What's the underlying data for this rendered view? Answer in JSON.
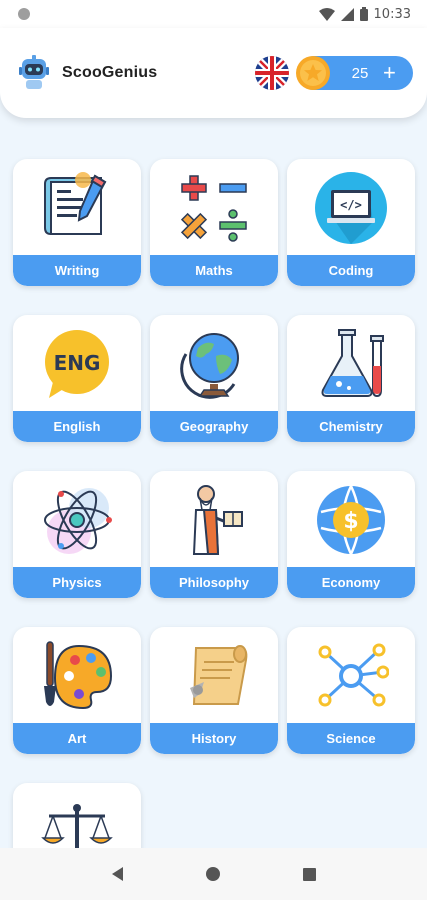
{
  "status_bar": {
    "time": "10:33"
  },
  "header": {
    "app_name": "ScooGenius",
    "language_flag": "uk-flag-icon",
    "coins": "25",
    "add_label": "+"
  },
  "subjects": [
    {
      "label": "Writing",
      "icon": "writing-icon"
    },
    {
      "label": "Maths",
      "icon": "maths-icon"
    },
    {
      "label": "Coding",
      "icon": "coding-icon"
    },
    {
      "label": "English",
      "icon": "english-icon",
      "badge": "ENG"
    },
    {
      "label": "Geography",
      "icon": "globe-icon"
    },
    {
      "label": "Chemistry",
      "icon": "chemistry-icon"
    },
    {
      "label": "Physics",
      "icon": "atom-icon"
    },
    {
      "label": "Philosophy",
      "icon": "philosopher-icon"
    },
    {
      "label": "Economy",
      "icon": "economy-icon",
      "badge": "$"
    },
    {
      "label": "Art",
      "icon": "palette-icon"
    },
    {
      "label": "History",
      "icon": "scroll-icon"
    },
    {
      "label": "Science",
      "icon": "network-icon"
    },
    {
      "label": "",
      "icon": "scales-icon"
    }
  ],
  "colors": {
    "accent": "#4b9cf1",
    "background": "#eef6fd"
  }
}
